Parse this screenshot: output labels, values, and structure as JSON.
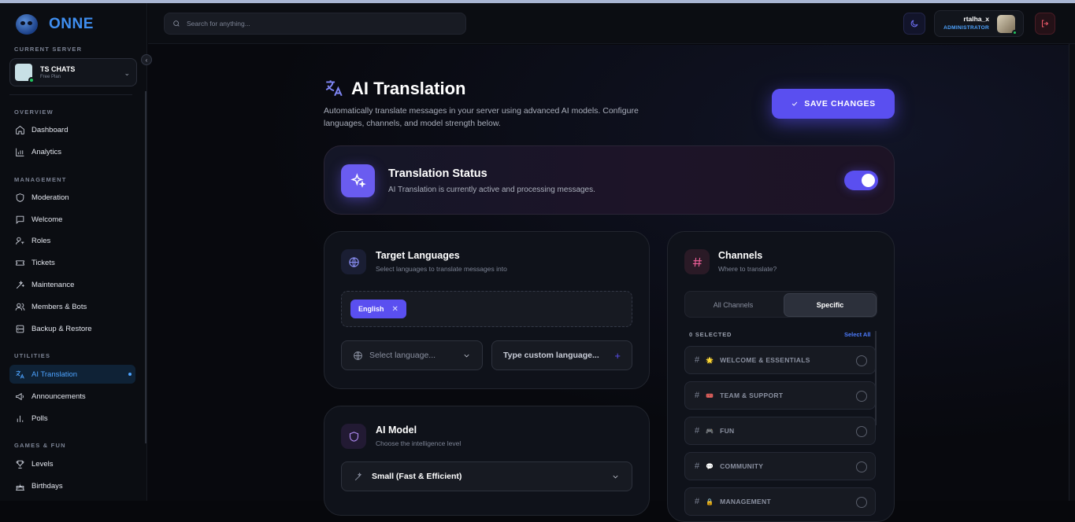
{
  "brand": {
    "name": "ONNE"
  },
  "sidebar": {
    "current_server_label": "CURRENT SERVER",
    "server": {
      "name": "TS CHATS",
      "plan": "Free Plan"
    },
    "sections": [
      {
        "label": "OVERVIEW",
        "items": [
          {
            "label": "Dashboard",
            "icon": "home-icon"
          },
          {
            "label": "Analytics",
            "icon": "bar-chart-icon"
          }
        ]
      },
      {
        "label": "MANAGEMENT",
        "items": [
          {
            "label": "Moderation",
            "icon": "shield-icon"
          },
          {
            "label": "Welcome",
            "icon": "message-square-icon"
          },
          {
            "label": "Roles",
            "icon": "user-key-icon"
          },
          {
            "label": "Tickets",
            "icon": "ticket-icon"
          },
          {
            "label": "Maintenance",
            "icon": "wand-icon"
          },
          {
            "label": "Members & Bots",
            "icon": "users-icon"
          },
          {
            "label": "Backup & Restore",
            "icon": "database-icon"
          }
        ]
      },
      {
        "label": "UTILITIES",
        "items": [
          {
            "label": "AI Translation",
            "icon": "translate-icon",
            "active": true
          },
          {
            "label": "Announcements",
            "icon": "megaphone-icon"
          },
          {
            "label": "Polls",
            "icon": "poll-icon"
          }
        ]
      },
      {
        "label": "GAMES & FUN",
        "items": [
          {
            "label": "Levels",
            "icon": "trophy-icon"
          },
          {
            "label": "Birthdays",
            "icon": "cake-icon"
          }
        ]
      }
    ]
  },
  "header": {
    "search_placeholder": "Search for anything...",
    "user": {
      "name": "rtalha_x",
      "role": "ADMINISTRATOR"
    }
  },
  "page": {
    "title": "AI Translation",
    "description": "Automatically translate messages in your server using advanced AI models. Configure languages, channels, and model strength below.",
    "save_label": "SAVE CHANGES"
  },
  "status": {
    "title": "Translation Status",
    "subtitle": "AI Translation is currently active and processing messages.",
    "enabled": true
  },
  "target_languages": {
    "title": "Target Languages",
    "subtitle": "Select languages to translate messages into",
    "selected": [
      "English"
    ],
    "select_placeholder": "Select language...",
    "custom_placeholder": "Type custom language..."
  },
  "ai_model": {
    "title": "AI Model",
    "subtitle": "Choose the intelligence level",
    "selected": "Small (Fast & Efficient)"
  },
  "channels": {
    "title": "Channels",
    "subtitle": "Where to translate?",
    "tabs": [
      "All Channels",
      "Specific"
    ],
    "active_tab": "Specific",
    "selected_count_label": "0 SELECTED",
    "select_all_label": "Select All",
    "list": [
      {
        "emoji": "🌟",
        "name": "WELCOME & ESSENTIALS"
      },
      {
        "emoji": "🎟️",
        "name": "TEAM & SUPPORT"
      },
      {
        "emoji": "🎮",
        "name": "FUN"
      },
      {
        "emoji": "💬",
        "name": "COMMUNITY"
      },
      {
        "emoji": "🔒",
        "name": "MANAGEMENT"
      }
    ]
  },
  "colors": {
    "accent": "#5a4ff0",
    "link": "#4da3ff",
    "online": "#22c55e",
    "danger": "#f05a6b"
  }
}
